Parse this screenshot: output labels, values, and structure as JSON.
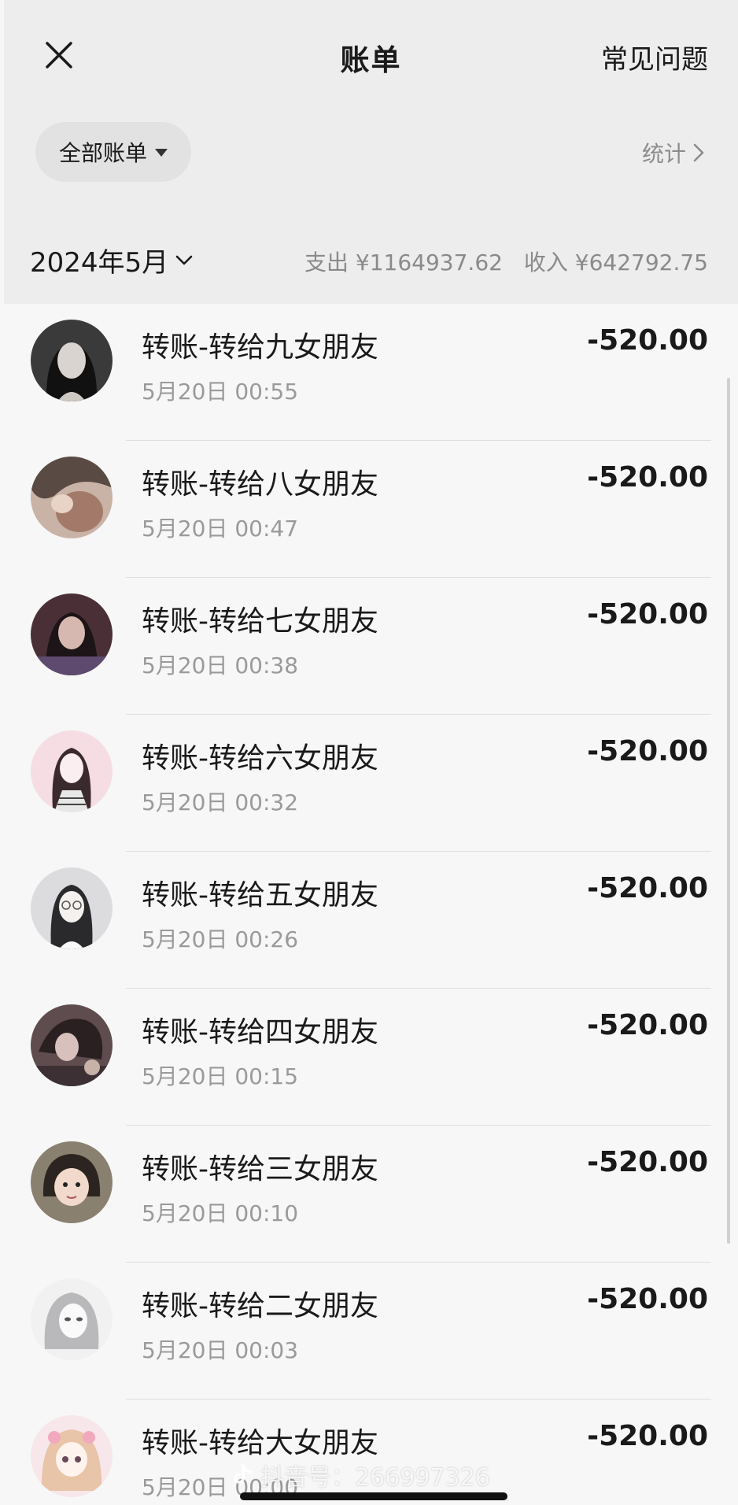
{
  "header": {
    "title": "账单",
    "faq_label": "常见问题",
    "close_icon": "close-icon"
  },
  "filter": {
    "label": "全部账单",
    "stats_label": "统计"
  },
  "month": {
    "label": "2024年5月",
    "expense": "支出 ¥1164937.62",
    "income": "收入 ¥642792.75"
  },
  "transactions": [
    {
      "title": "转账-转给九女朋友",
      "time": "5月20日 00:55",
      "amount": "-520.00"
    },
    {
      "title": "转账-转给八女朋友",
      "time": "5月20日 00:47",
      "amount": "-520.00"
    },
    {
      "title": "转账-转给七女朋友",
      "time": "5月20日 00:38",
      "amount": "-520.00"
    },
    {
      "title": "转账-转给六女朋友",
      "time": "5月20日 00:32",
      "amount": "-520.00"
    },
    {
      "title": "转账-转给五女朋友",
      "time": "5月20日 00:26",
      "amount": "-520.00"
    },
    {
      "title": "转账-转给四女朋友",
      "time": "5月20日 00:15",
      "amount": "-520.00"
    },
    {
      "title": "转账-转给三女朋友",
      "time": "5月20日 00:10",
      "amount": "-520.00"
    },
    {
      "title": "转账-转给二女朋友",
      "time": "5月20日 00:03",
      "amount": "-520.00"
    },
    {
      "title": "转账-转给大女朋友",
      "time": "5月20日 00:00",
      "amount": "-520.00"
    }
  ],
  "watermark": "抖音号：266997326",
  "colors": {
    "header_bg": "#ededed",
    "list_bg": "#f7f7f7",
    "muted_text": "#9a9a9a",
    "primary_text": "#1a1a1a"
  }
}
